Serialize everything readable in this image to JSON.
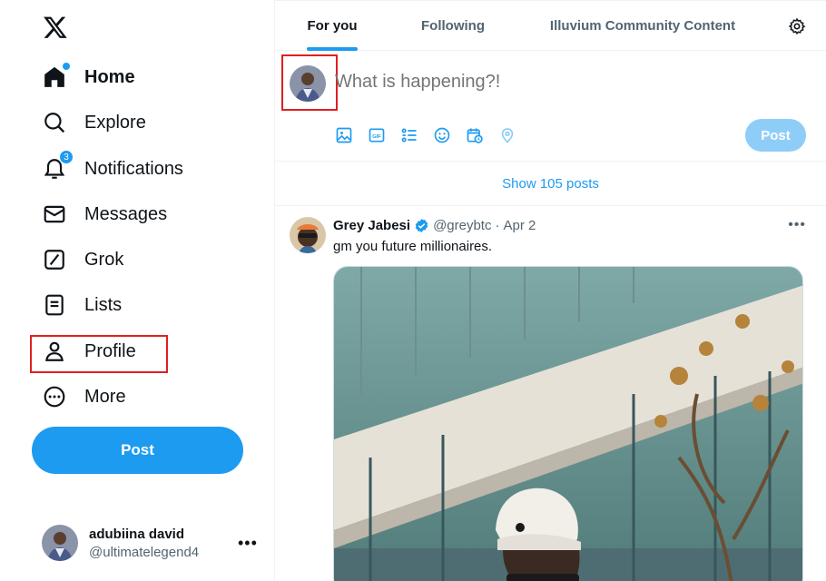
{
  "sidebar": {
    "logo": "x-logo-icon",
    "items": [
      {
        "label": "Home",
        "icon": "home-icon"
      },
      {
        "label": "Explore",
        "icon": "search-icon"
      },
      {
        "label": "Notifications",
        "icon": "bell-icon",
        "badge": "3"
      },
      {
        "label": "Messages",
        "icon": "envelope-icon"
      },
      {
        "label": "Grok",
        "icon": "grok-icon"
      },
      {
        "label": "Lists",
        "icon": "list-icon"
      },
      {
        "label": "Profile",
        "icon": "person-icon"
      },
      {
        "label": "More",
        "icon": "more-circle-icon"
      }
    ],
    "post_label": "Post",
    "account": {
      "name": "adubiina david",
      "handle": "@ultimatelegend4"
    }
  },
  "tabs": [
    {
      "label": "For you",
      "active": true
    },
    {
      "label": "Following",
      "active": false
    },
    {
      "label": "Illuvium Community Content",
      "active": false
    }
  ],
  "composer": {
    "placeholder": "What is happening?!",
    "post_label": "Post",
    "tools": [
      "image-icon",
      "gif-icon",
      "poll-icon",
      "emoji-icon",
      "schedule-icon",
      "location-icon"
    ]
  },
  "show_posts": "Show 105 posts",
  "tweet": {
    "name": "Grey Jabesi",
    "handle": "@greybtc",
    "dot": "·",
    "date": "Apr 2",
    "text": "gm you future millionaires."
  },
  "colors": {
    "accent": "#1d9bf0",
    "highlight": "#e01f1f",
    "text_secondary": "#536471"
  }
}
